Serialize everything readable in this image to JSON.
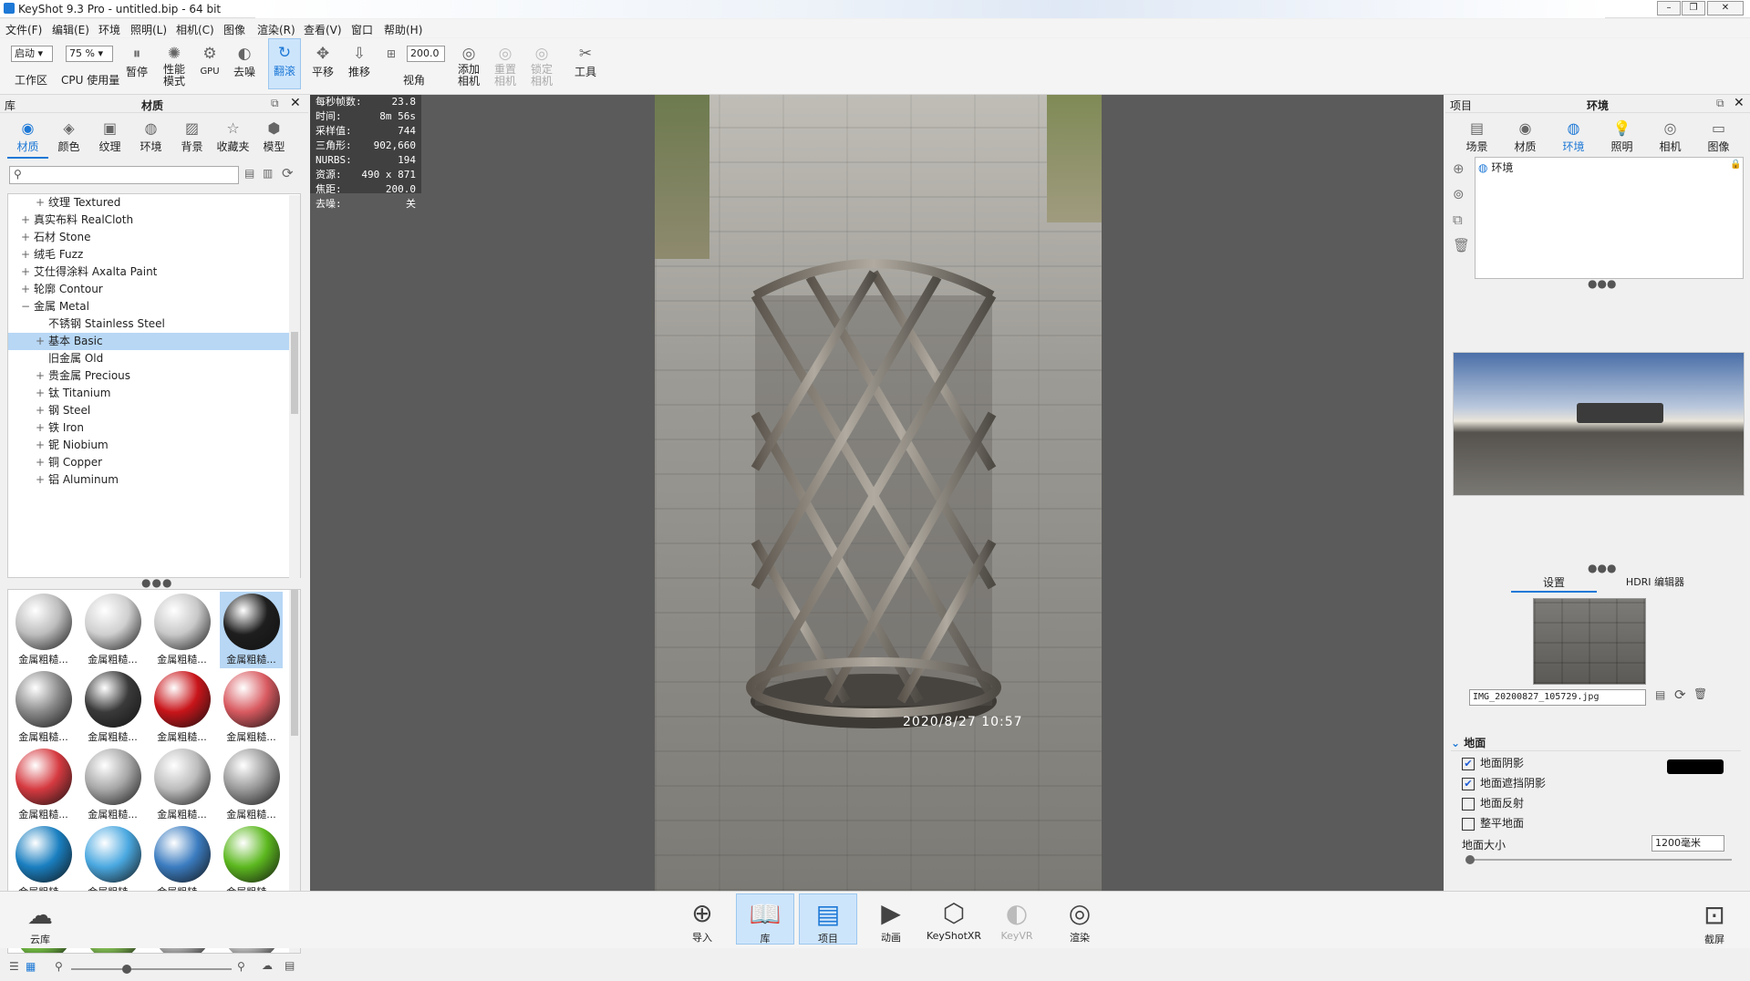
{
  "window": {
    "title": "KeyShot 9.3 Pro  - untitled.bip  - 64 bit"
  },
  "menu": [
    "文件(F)",
    "编辑(E)",
    "环境",
    "照明(L)",
    "相机(C)",
    "图像",
    "渲染(R)",
    "查看(V)",
    "窗口",
    "帮助(H)"
  ],
  "toolbar": {
    "workspace_value": "启动",
    "workspace_label": "工作区",
    "cpu_value": "75 %",
    "cpu_label": "CPU 使用量",
    "pause": "暂停",
    "perf": "性能\n模式",
    "gpu": "GPU",
    "denoise": "去噪",
    "tumble": "翻滚",
    "pan": "平移",
    "dolly": "推移",
    "fov_value": "200.0",
    "view": "视角",
    "add_camera": "添加\n相机",
    "reset_camera": "重置\n相机",
    "lock_camera": "锁定\n相机",
    "tools": "工具"
  },
  "library": {
    "panel_label": "库",
    "title": "材质",
    "tabs": [
      "材质",
      "颜色",
      "纹理",
      "环境",
      "背景",
      "收藏夹",
      "模型"
    ],
    "tree": [
      {
        "label": "纹理 Textured",
        "indent": 2,
        "expander": "+"
      },
      {
        "label": "真实布料 RealCloth",
        "indent": 1,
        "expander": "+"
      },
      {
        "label": "石材 Stone",
        "indent": 1,
        "expander": "+"
      },
      {
        "label": "绒毛 Fuzz",
        "indent": 1,
        "expander": "+"
      },
      {
        "label": "艾仕得涂料 Axalta Paint",
        "indent": 1,
        "expander": "+"
      },
      {
        "label": "轮廓 Contour",
        "indent": 1,
        "expander": "+"
      },
      {
        "label": "金属 Metal",
        "indent": 1,
        "expander": "−"
      },
      {
        "label": "不锈钢 Stainless Steel",
        "indent": 2,
        "expander": ""
      },
      {
        "label": "基本 Basic",
        "indent": 2,
        "expander": "+",
        "selected": true
      },
      {
        "label": "旧金属 Old",
        "indent": 2,
        "expander": ""
      },
      {
        "label": "贵金属 Precious",
        "indent": 2,
        "expander": "+"
      },
      {
        "label": "钛 Titanium",
        "indent": 2,
        "expander": "+"
      },
      {
        "label": "钢 Steel",
        "indent": 2,
        "expander": "+"
      },
      {
        "label": "铁 Iron",
        "indent": 2,
        "expander": "+"
      },
      {
        "label": "铌 Niobium",
        "indent": 2,
        "expander": "+"
      },
      {
        "label": "铜 Copper",
        "indent": 2,
        "expander": "+"
      },
      {
        "label": "铝 Aluminum",
        "indent": 2,
        "expander": "+"
      }
    ],
    "thumb_label": "金属粗糙...",
    "thumb_colors": [
      "#bdbdbd",
      "#cfcfcf",
      "#c8c8c8",
      "#1e1e1e",
      "#8a8a8a",
      "#3a3a3a",
      "#c8151a",
      "#d85a60",
      "#d53a40",
      "#a8a8a8",
      "#bcbcbc",
      "#9a9a9a",
      "#1a7fc0",
      "#4aa8e0",
      "#3b7cc0",
      "#5cb81f",
      "#7ed04a",
      "#8ed05a",
      "#c0c0c0",
      "#d0d0d0"
    ]
  },
  "stats": [
    {
      "k": "每秒帧数:",
      "v": "23.8"
    },
    {
      "k": "时间:",
      "v": "8m 56s"
    },
    {
      "k": "采样值:",
      "v": "744"
    },
    {
      "k": "三角形:",
      "v": "902,660"
    },
    {
      "k": "NURBS:",
      "v": "194"
    },
    {
      "k": "资源:",
      "v": "490 x 871"
    },
    {
      "k": "焦距:",
      "v": "200.0"
    },
    {
      "k": "去噪:",
      "v": "关"
    }
  ],
  "photo_stamp": "2020/8/27  10:57",
  "project": {
    "panel_label": "项目",
    "title": "环境",
    "tabs": [
      "场景",
      "材质",
      "环境",
      "照明",
      "相机",
      "图像"
    ],
    "env_item": "环境",
    "subtabs": [
      "设置",
      "HDRI 编辑器"
    ],
    "bg_file": "IMG_20200827_105729.jpg",
    "ground_section": "地面",
    "ground_options": [
      {
        "label": "地面阴影",
        "checked": true
      },
      {
        "label": "地面遮挡阴影",
        "checked": true
      },
      {
        "label": "地面反射",
        "checked": false
      },
      {
        "label": "整平地面",
        "checked": false
      }
    ],
    "ground_size_label": "地面大小",
    "ground_size_value": "1200毫米",
    "shadow_color": "#000000"
  },
  "bottom": {
    "cloud": "云库",
    "buttons": [
      "导入",
      "库",
      "项目",
      "动画",
      "KeyShotXR",
      "KeyVR",
      "渲染"
    ],
    "screenshot": "截屏"
  },
  "colors": {
    "accent": "#1d78d6",
    "selected_row": "#b7d7f5",
    "viewport": "#5b5b5b"
  }
}
